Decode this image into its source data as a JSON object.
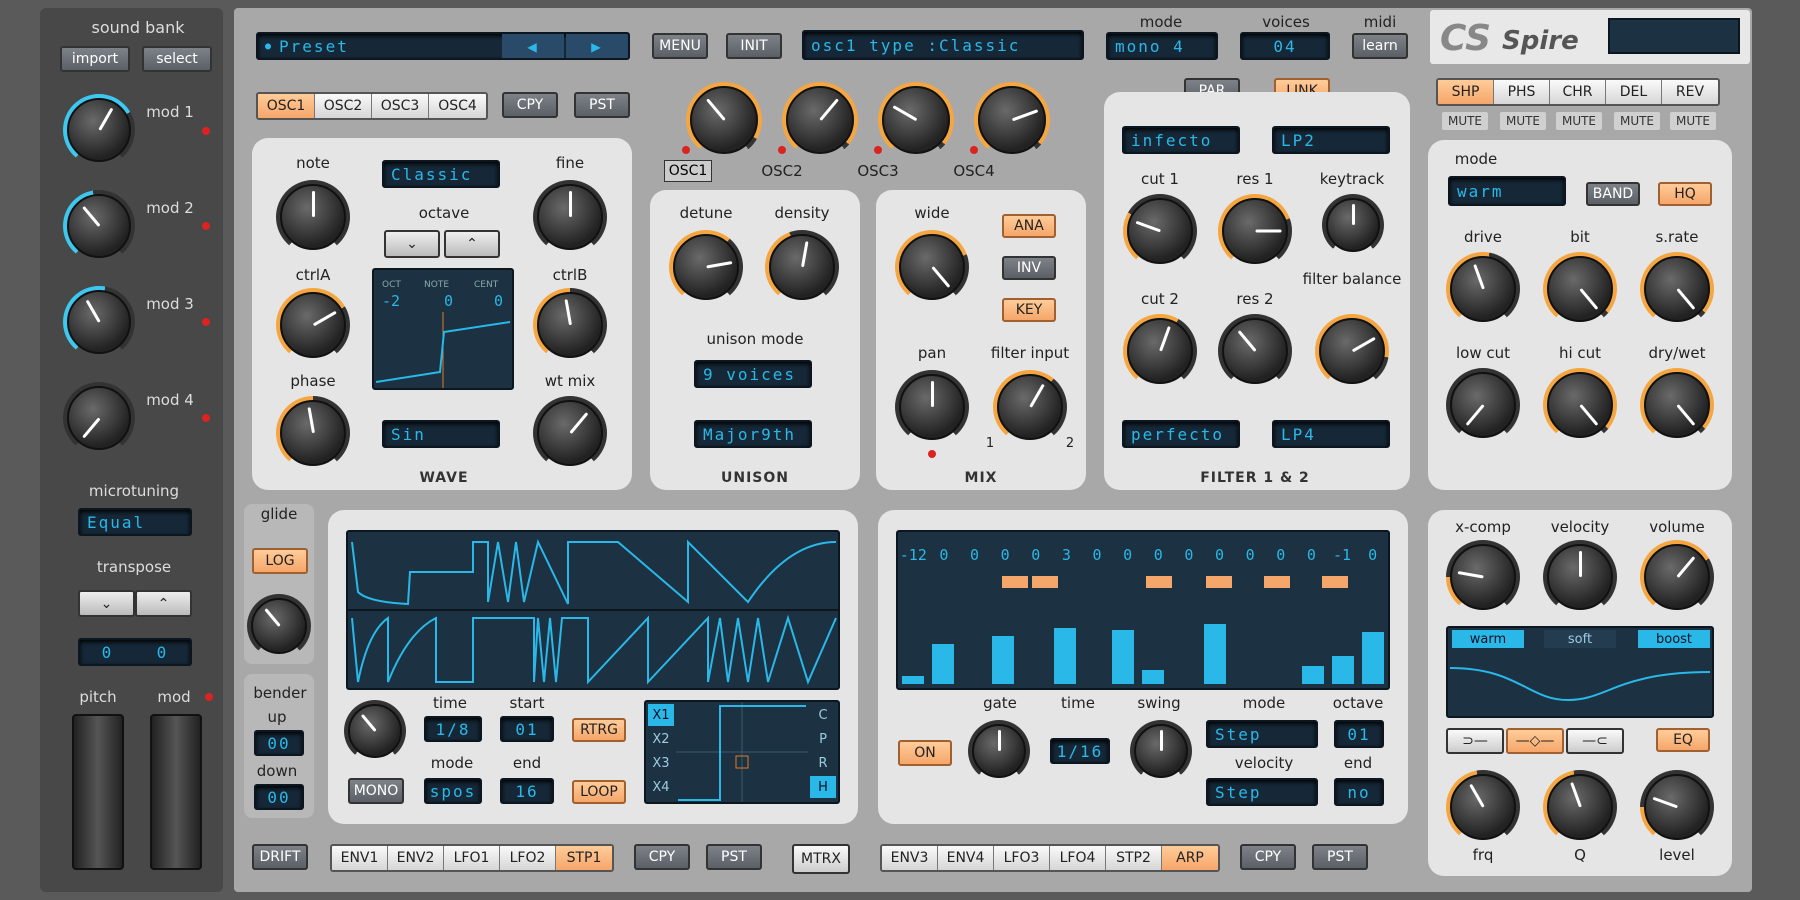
{
  "sidebar": {
    "sound_bank": "sound bank",
    "import": "import",
    "select": "select",
    "mod1": "mod 1",
    "mod2": "mod 2",
    "mod3": "mod 3",
    "mod4": "mod 4",
    "microtuning": "microtuning",
    "tuning_value": "Equal",
    "transpose": "transpose",
    "transpose_a": "0",
    "transpose_b": "0",
    "pitch": "pitch",
    "mod": "mod"
  },
  "top": {
    "preset": "Preset",
    "menu": "MENU",
    "init": "INIT",
    "osc_type": "osc1 type  :Classic",
    "mode_label": "mode",
    "mode_value": "mono 4",
    "voices_label": "voices",
    "voices_value": "04",
    "midi_label": "midi",
    "learn": "learn",
    "logo": "Spire"
  },
  "osc": {
    "tabs": [
      "OSC1",
      "OSC2",
      "OSC3",
      "OSC4"
    ],
    "cpy": "CPY",
    "pst": "PST",
    "note": "note",
    "fine": "fine",
    "wave_type": "Classic",
    "octave": "octave",
    "ctrlA": "ctrlA",
    "ctrlB": "ctrlB",
    "phase": "phase",
    "wt_mix": "wt mix",
    "wave_shape": "Sin",
    "section": "WAVE",
    "disp_oct": "OCT",
    "disp_note": "NOTE",
    "disp_cent": "CENT",
    "oct_val": "-2",
    "note_val": "0",
    "cent_val": "0"
  },
  "osc_mix": {
    "labels": [
      "OSC1",
      "OSC2",
      "OSC3",
      "OSC4"
    ]
  },
  "unison": {
    "detune": "detune",
    "density": "density",
    "mode_label": "unison mode",
    "voices": "9 voices",
    "chord": "Major9th",
    "section": "UNISON"
  },
  "mix": {
    "wide": "wide",
    "ana": "ANA",
    "inv": "INV",
    "key": "KEY",
    "pan": "pan",
    "filter_input": "filter input",
    "in1": "1",
    "in2": "2",
    "section": "MIX"
  },
  "filter": {
    "par": "PAR",
    "link": "LINK",
    "type1": "infecto",
    "mode1": "LP2",
    "cut1": "cut 1",
    "res1": "res 1",
    "keytrack": "keytrack",
    "cut2": "cut 2",
    "res2": "res 2",
    "balance": "filter balance",
    "type2": "perfecto",
    "mode2": "LP4",
    "section": "FILTER 1 & 2"
  },
  "fx": {
    "tabs": [
      "SHP",
      "PHS",
      "CHR",
      "DEL",
      "REV"
    ],
    "mute": "MUTE",
    "mode": "mode",
    "mode_value": "warm",
    "band": "BAND",
    "hq": "HQ",
    "drive": "drive",
    "bit": "bit",
    "srate": "s.rate",
    "low_cut": "low cut",
    "hi_cut": "hi cut",
    "dry_wet": "dry/wet"
  },
  "eq": {
    "xcomp": "x-comp",
    "velocity": "velocity",
    "volume": "volume",
    "warm": "warm",
    "soft": "soft",
    "boost": "boost",
    "eq": "EQ",
    "frq": "frq",
    "q": "Q",
    "level": "level"
  },
  "glide": {
    "glide": "glide",
    "log": "LOG",
    "bender": "bender",
    "up": "up",
    "up_val": "00",
    "down": "down",
    "down_val": "00",
    "drift": "DRIFT"
  },
  "stp": {
    "time": "time",
    "time_val": "1/8",
    "start": "start",
    "start_val": "01",
    "rtrg": "RTRG",
    "mono": "MONO",
    "mode": "mode",
    "mode_val": "spos",
    "end": "end",
    "end_val": "16",
    "loop": "LOOP",
    "xs": [
      "X1",
      "X2",
      "X3",
      "X4"
    ],
    "cprh": [
      "C",
      "P",
      "R",
      "H"
    ],
    "tabs": [
      "ENV1",
      "ENV2",
      "LFO1",
      "LFO2",
      "STP1"
    ],
    "cpy": "CPY",
    "pst": "PST",
    "mtrx": "MTRX"
  },
  "arp": {
    "steps": [
      "-12",
      "0",
      "0",
      "0",
      "0",
      "3",
      "0",
      "0",
      "0",
      "0",
      "0",
      "0",
      "0",
      "0",
      "-1",
      "0"
    ],
    "on": "ON",
    "gate": "gate",
    "time": "time",
    "time_val": "1/16",
    "swing": "swing",
    "mode": "mode",
    "mode_val": "Step",
    "octave": "octave",
    "octave_val": "01",
    "velocity": "velocity",
    "velocity_val": "Step",
    "end": "end",
    "end_val": "no",
    "tabs": [
      "ENV3",
      "ENV4",
      "LFO3",
      "LFO4",
      "STP2",
      "ARP"
    ],
    "cpy": "CPY",
    "pst": "PST"
  }
}
